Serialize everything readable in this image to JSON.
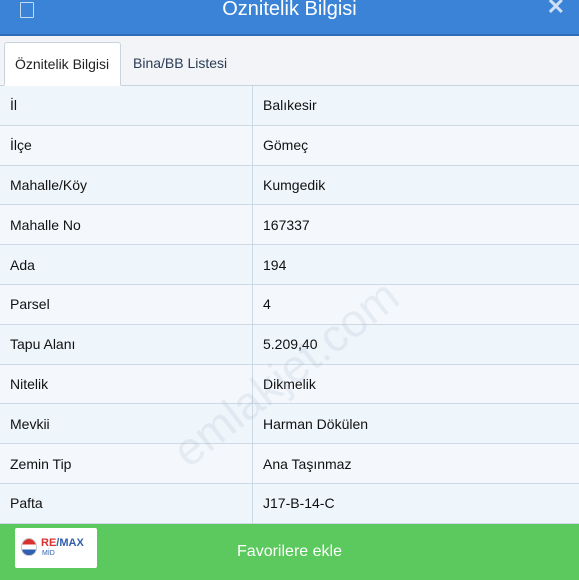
{
  "window": {
    "title": "Öznitelik Bilgisi",
    "close_icon": "close-icon"
  },
  "tabs": [
    {
      "label": "Öznitelik Bilgisi",
      "active": true
    },
    {
      "label": "Bina/BB Listesi",
      "active": false
    }
  ],
  "rows": [
    {
      "key": "İl",
      "value": "Balıkesir"
    },
    {
      "key": "İlçe",
      "value": "Gömeç"
    },
    {
      "key": "Mahalle/Köy",
      "value": "Kumgedik"
    },
    {
      "key": "Mahalle No",
      "value": "167337"
    },
    {
      "key": "Ada",
      "value": "194"
    },
    {
      "key": "Parsel",
      "value": "4"
    },
    {
      "key": "Tapu Alanı",
      "value": "5.209,40"
    },
    {
      "key": "Nitelik",
      "value": "Dikmelik"
    },
    {
      "key": "Mevkii",
      "value": "Harman Dökülen"
    },
    {
      "key": "Zemin Tip",
      "value": "Ana Taşınmaz"
    },
    {
      "key": "Pafta",
      "value": "J17-B-14-C"
    }
  ],
  "watermark": "emlakjet.com",
  "footer": {
    "button_label": "Favorilere ekle",
    "logo": {
      "brand_text_red": "RE",
      "brand_text_blue": "/MAX",
      "sub_text": "MİD"
    }
  },
  "colors": {
    "titlebar": "#3a83d6",
    "footer": "#5cc95e",
    "table_bg": "#eef5fb"
  }
}
